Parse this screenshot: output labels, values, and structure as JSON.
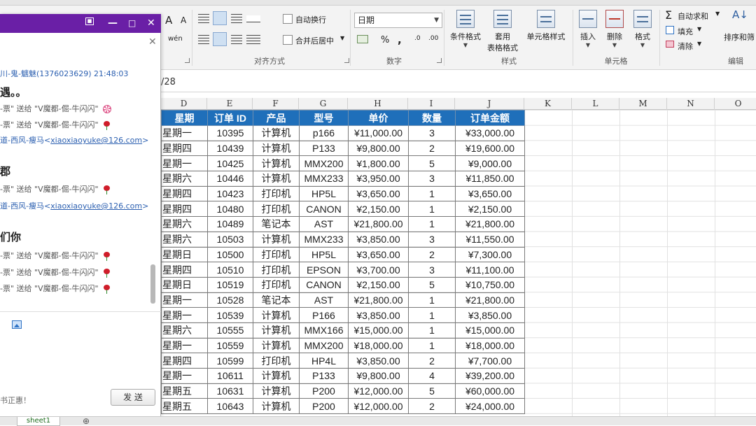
{
  "ribbon": {
    "font_group": {
      "grow": "A",
      "shrink": "A",
      "phonetic": "wén"
    },
    "alignment": {
      "wrap_text": "自动换行",
      "merge_center": "合并后居中",
      "label": "对齐方式"
    },
    "number": {
      "format_value": "日期",
      "percent": "%",
      "comma": ",",
      "label": "数字"
    },
    "styles": {
      "conditional": "条件格式",
      "table_line1": "套用",
      "table_line2": "表格格式",
      "cell_styles": "单元格样式",
      "label": "样式"
    },
    "cells": {
      "insert": "插入",
      "delete": "删除",
      "format": "格式",
      "label": "单元格"
    },
    "editing": {
      "autosum": "自动求和",
      "fill": "填充",
      "clear": "清除",
      "sort": "排序和筛",
      "label": "编辑"
    }
  },
  "formula_bar": {
    "partial_value": "/28"
  },
  "columns": [
    "D",
    "E",
    "F",
    "G",
    "H",
    "I",
    "J",
    "K",
    "L",
    "M",
    "N",
    "O"
  ],
  "table": {
    "headers": [
      "星期",
      "订单 ID",
      "产品",
      "型号",
      "单价",
      "数量",
      "订单金额"
    ],
    "rows": [
      [
        "星期一",
        "10395",
        "计算机",
        "p166",
        "¥11,000.00",
        "3",
        "¥33,000.00"
      ],
      [
        "星期四",
        "10439",
        "计算机",
        "P133",
        "¥9,800.00",
        "2",
        "¥19,600.00"
      ],
      [
        "星期一",
        "10425",
        "计算机",
        "MMX200",
        "¥1,800.00",
        "5",
        "¥9,000.00"
      ],
      [
        "星期六",
        "10446",
        "计算机",
        "MMX233",
        "¥3,950.00",
        "3",
        "¥11,850.00"
      ],
      [
        "星期四",
        "10423",
        "打印机",
        "HP5L",
        "¥3,650.00",
        "1",
        "¥3,650.00"
      ],
      [
        "星期四",
        "10480",
        "打印机",
        "CANON",
        "¥2,150.00",
        "1",
        "¥2,150.00"
      ],
      [
        "星期六",
        "10489",
        "笔记本",
        "AST",
        "¥21,800.00",
        "1",
        "¥21,800.00"
      ],
      [
        "星期六",
        "10503",
        "计算机",
        "MMX233",
        "¥3,850.00",
        "3",
        "¥11,550.00"
      ],
      [
        "星期日",
        "10500",
        "打印机",
        "HP5L",
        "¥3,650.00",
        "2",
        "¥7,300.00"
      ],
      [
        "星期四",
        "10510",
        "打印机",
        "EPSON",
        "¥3,700.00",
        "3",
        "¥11,100.00"
      ],
      [
        "星期日",
        "10519",
        "打印机",
        "CANON",
        "¥2,150.00",
        "5",
        "¥10,750.00"
      ],
      [
        "星期一",
        "10528",
        "笔记本",
        "AST",
        "¥21,800.00",
        "1",
        "¥21,800.00"
      ],
      [
        "星期一",
        "10539",
        "计算机",
        "P166",
        "¥3,850.00",
        "1",
        "¥3,850.00"
      ],
      [
        "星期六",
        "10555",
        "计算机",
        "MMX166",
        "¥15,000.00",
        "1",
        "¥15,000.00"
      ],
      [
        "星期一",
        "10559",
        "计算机",
        "MMX200",
        "¥18,000.00",
        "1",
        "¥18,000.00"
      ],
      [
        "星期四",
        "10599",
        "打印机",
        "HP4L",
        "¥3,850.00",
        "2",
        "¥7,700.00"
      ],
      [
        "星期一",
        "10611",
        "计算机",
        "P133",
        "¥9,800.00",
        "4",
        "¥39,200.00"
      ],
      [
        "星期五",
        "10631",
        "计算机",
        "P200",
        "¥12,000.00",
        "5",
        "¥60,000.00"
      ],
      [
        "星期五",
        "10643",
        "计算机",
        "P200",
        "¥12,000.00",
        "2",
        "¥24,000.00"
      ]
    ]
  },
  "chat": {
    "sender_line": "川-鬼-魑魅(1376023629)  21:48:03",
    "msg1": "遇。。",
    "gift1": "-票\" 送给 \"V魔都-倔-牛闪闪\"",
    "gift2": "-票\" 送给 \"V魔都-倔-牛闪闪\"",
    "email_name1": "道-西风-瘦马<",
    "email1": "xiaoxiaoyuke@126.com",
    "email_close1": ">",
    "msg2": "郡",
    "gift3": "-票\" 送给 \"V魔都-倔-牛闪闪\"",
    "email_name2": "道-西风-瘦马<",
    "email2": "xiaoxiaoyuke@126.com",
    "email_close2": ">",
    "msg3": "们你",
    "gift4": "-票\" 送给 \"V魔都-倔-牛闪闪\"",
    "gift5": "-票\" 送给 \"V魔都-倔-牛闪闪\"",
    "gift6": "-票\" 送给 \"V魔都-倔-牛闪闪\"",
    "input_hint": "书正惠！",
    "send": "发 送"
  },
  "sheets": {
    "tab": "sheet1",
    "add": "⊕"
  }
}
